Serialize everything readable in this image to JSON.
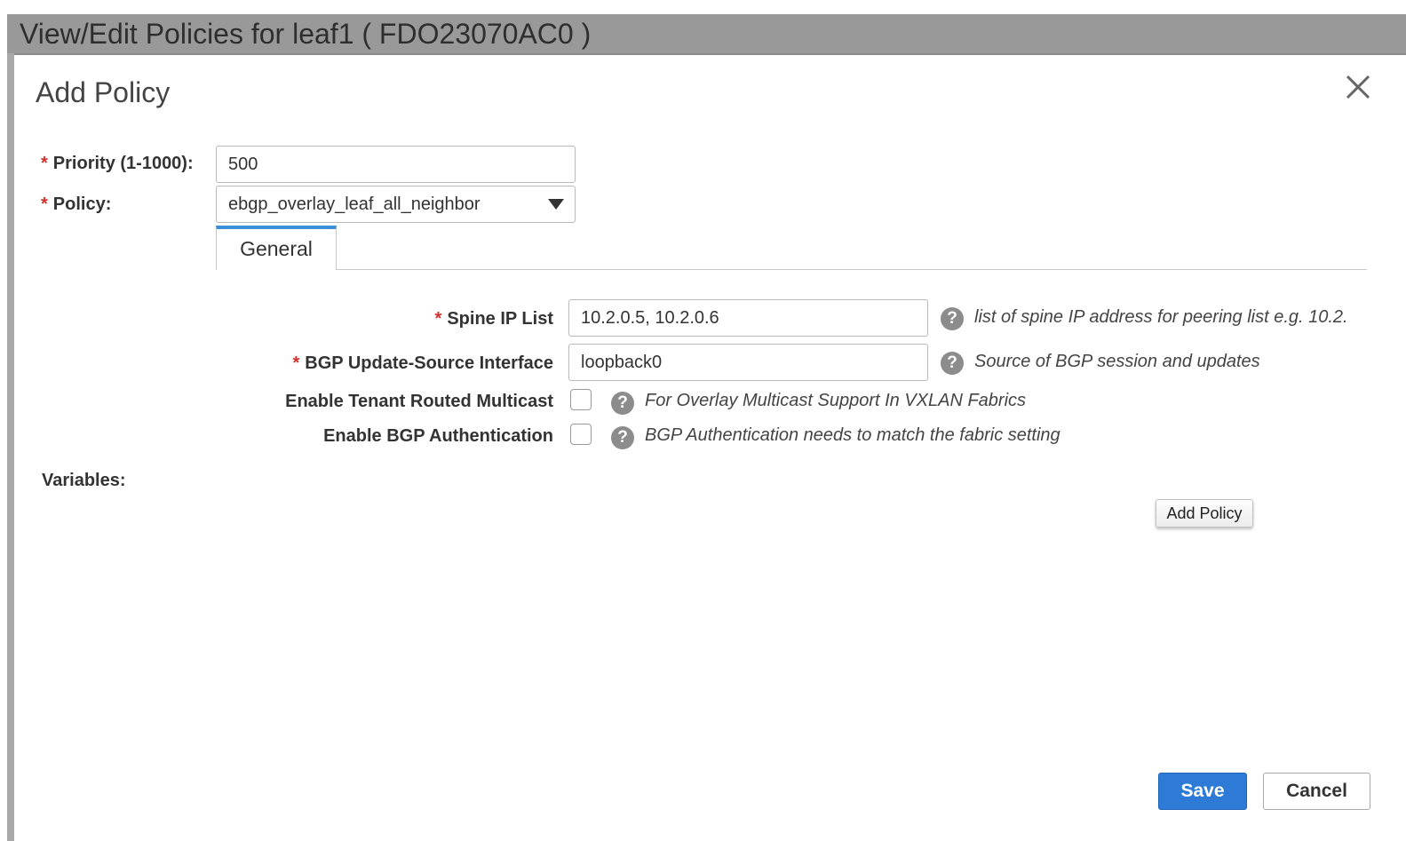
{
  "window": {
    "title": "View/Edit Policies for leaf1 ( FDO23070AC0 )"
  },
  "dialog": {
    "title": "Add Policy",
    "close_icon": "close-icon"
  },
  "form": {
    "required_marker": "*",
    "priority_label": "Priority (1-1000):",
    "priority_value": "500",
    "policy_label": "Policy:",
    "policy_value": "ebgp_overlay_leaf_all_neighbor",
    "variables_label": "Variables:"
  },
  "tabs": [
    {
      "label": "General",
      "active": true
    }
  ],
  "general": {
    "help_icon_glyph": "?",
    "spine_ip": {
      "label": "Spine IP List",
      "value": "10.2.0.5, 10.2.0.6",
      "hint": "list of spine IP address for peering list e.g. 10.2."
    },
    "bgp_update_source": {
      "label": "BGP Update-Source Interface",
      "value": "loopback0",
      "hint": "Source of BGP session and updates"
    },
    "tenant_multicast": {
      "label": "Enable Tenant Routed Multicast",
      "checked": false,
      "hint": "For Overlay Multicast Support In VXLAN Fabrics"
    },
    "bgp_auth": {
      "label": "Enable BGP Authentication",
      "checked": false,
      "hint": "BGP Authentication needs to match the fabric setting"
    }
  },
  "buttons": {
    "add_policy": "Add Policy",
    "save": "Save",
    "cancel": "Cancel"
  },
  "colors": {
    "primary": "#2d7bd6",
    "required": "#d0312d",
    "tab_accent": "#3a8fd8",
    "titlebar": "#999999"
  }
}
